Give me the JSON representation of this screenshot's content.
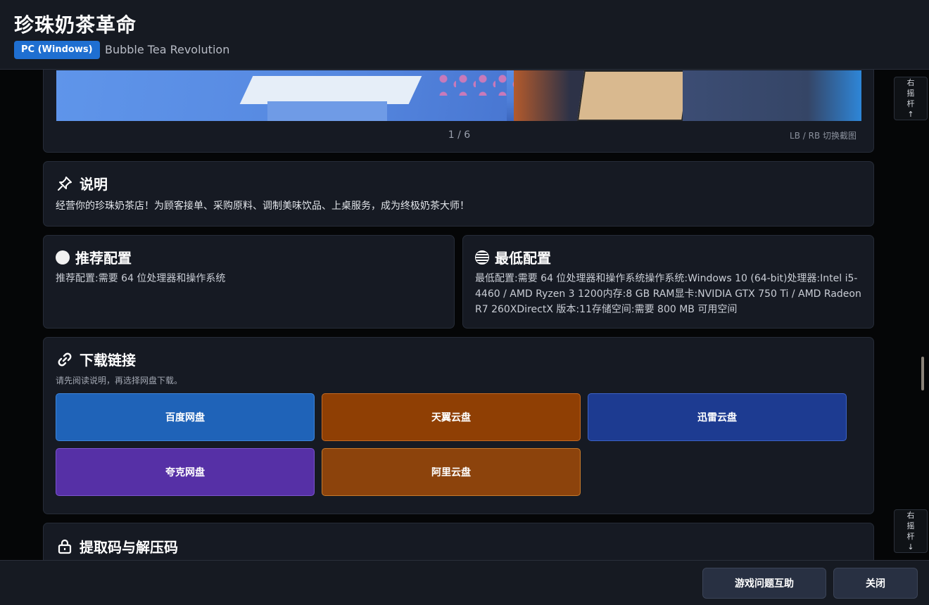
{
  "header": {
    "title": "珍珠奶茶革命",
    "platform": "PC (Windows)",
    "english_title": "Bubble Tea Revolution"
  },
  "screenshots": {
    "counter": "1 / 6",
    "hint": "LB / RB 切换截图"
  },
  "description": {
    "title": "说明",
    "icon": "pin-icon",
    "text": "经营你的珍珠奶茶店！为顾客接单、采购原料、调制美味饮品、上桌服务，成为终极奶茶大师！"
  },
  "recommended": {
    "title": "推荐配置",
    "icon": "circle-icon",
    "text": "推荐配置:需要 64 位处理器和操作系统"
  },
  "minimum": {
    "title": "最低配置",
    "icon": "disc-icon",
    "text": "最低配置:需要 64 位处理器和操作系统操作系统:Windows 10 (64-bit)处理器:Intel i5-4460 / AMD Ryzen 3 1200内存:8 GB RAM显卡:NVIDIA GTX 750 Ti / AMD Radeon R7 260XDirectX 版本:11存储空间:需要 800 MB 可用空间"
  },
  "downloads": {
    "title": "下载链接",
    "icon": "link-icon",
    "hint": "请先阅读说明，再选择网盘下载。",
    "buttons": {
      "baidu": "百度网盘",
      "tianyi": "天翼云盘",
      "xunlei": "迅雷云盘",
      "quark": "夸克网盘",
      "ali": "阿里云盘"
    },
    "colors": {
      "baidu": "#1f63b8",
      "tianyi": "#8f3f04",
      "xunlei": "#1d3b91",
      "quark": "#5630a6",
      "ali": "#8c430c"
    }
  },
  "extract": {
    "title": "提取码与解压码",
    "icon": "lock-icon"
  },
  "stick_hints": {
    "up": [
      "右",
      "摇",
      "杆",
      "↑"
    ],
    "down": [
      "右",
      "摇",
      "杆",
      "↓"
    ]
  },
  "footer": {
    "help": "游戏问题互助",
    "close": "关闭"
  }
}
